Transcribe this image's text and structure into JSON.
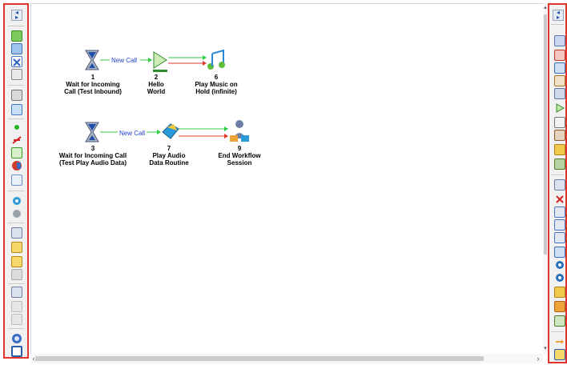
{
  "workflow": {
    "row1": {
      "node1": {
        "number": "1",
        "line1": "Wait for Incoming",
        "line2": "Call (Test Inbound)"
      },
      "edge1": {
        "label": "New Call"
      },
      "node2": {
        "number": "2",
        "line1": "Hello",
        "line2": "World"
      },
      "node3": {
        "number": "6",
        "line1": "Play Music on",
        "line2": "Hold (infinite)"
      }
    },
    "row2": {
      "node1": {
        "number": "3",
        "line1": "Wait for Incoming Call",
        "line2": "(Test Play Audio Data)"
      },
      "edge1": {
        "label": "New Call"
      },
      "node2": {
        "number": "7",
        "line1": "Play Audio",
        "line2": "Data Routine"
      },
      "node3": {
        "number": "9",
        "line1": "End Workflow",
        "line2": "Session"
      }
    }
  },
  "colors": {
    "toolbar_highlight": "#e0342c",
    "edge_true": "#2ecc40",
    "edge_false": "#e0342c",
    "edge_label": "#1d3fc9"
  },
  "icons": {
    "left_toolbar": [
      "collapse-toggle-icon",
      "green-square-icon",
      "copy-blocks-icon",
      "branch-x-icon",
      "dial-icon",
      "phone-hook-icon",
      "transfer-icon",
      "green-dot-icon",
      "record-icon",
      "green-exit-icon",
      "red-phone-icon",
      "list-icon",
      "audio-icon",
      "conference-icon",
      "hourglass-icon",
      "email-icon",
      "email-open-icon",
      "link-icon",
      "hourglass-alt-icon",
      "arrow-icon",
      "sound-icon",
      "globe-icon",
      "window-icon"
    ],
    "right_toolbar": [
      "collapse-toggle-icon",
      "user-icon",
      "record-icon",
      "person-icon",
      "transfer-icon",
      "person-alt-icon",
      "play-icon",
      "square-icon",
      "phone-icon",
      "exit-icon",
      "database-icon",
      "hourglass-icon",
      "cancel-icon",
      "music-icon",
      "query-icon",
      "query-alt-icon",
      "person-stack-icon",
      "audio-icon",
      "audio-alt-icon",
      "person-gear-icon",
      "person-warning-icon",
      "config-icon",
      "arrow-icon",
      "email-icon"
    ]
  }
}
